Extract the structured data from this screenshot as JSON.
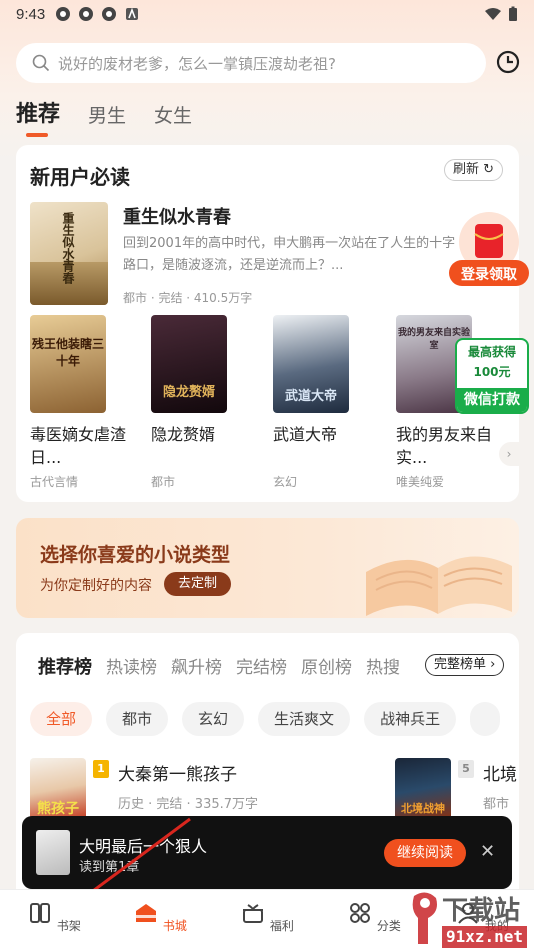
{
  "status": {
    "time": "9:43"
  },
  "search": {
    "placeholder": "说好的废材老爹，怎么一掌镇压渡劫老祖?"
  },
  "tabs": [
    {
      "label": "推荐"
    },
    {
      "label": "男生"
    },
    {
      "label": "女生"
    }
  ],
  "new_user": {
    "title": "新用户必读",
    "refresh_label": "刷新",
    "featured": {
      "title": "重生似水青春",
      "cover_text": "重生似水青春",
      "description": "回到2001年的高中时代，申大鹏再一次站在了人生的十字路口，是随波逐流，还是逆流而上？...",
      "meta": "都市 · 完结 · 410.5万字"
    },
    "books": [
      {
        "title": "毒医嫡女虐渣日...",
        "category": "古代言情",
        "cover_text": "残王他装瞎三十年",
        "colors": [
          "#d9b27a",
          "#6a4a26"
        ]
      },
      {
        "title": "隐龙赘婿",
        "category": "都市",
        "cover_text": "隐龙赘婿",
        "colors": [
          "#3a1f2a",
          "#1a0f14"
        ]
      },
      {
        "title": "武道大帝",
        "category": "玄幻",
        "cover_text": "武道大帝",
        "colors": [
          "#dfe5ea",
          "#2b3b52"
        ]
      },
      {
        "title": "我的男友来自实...",
        "category": "唯美纯爱",
        "cover_text": "我的男友来自实验室",
        "colors": [
          "#c9ccd4",
          "#5a4a5a"
        ]
      }
    ]
  },
  "float": {
    "gift_label": "登录领取",
    "wechat_top": "最高获得",
    "wechat_amount": "100元",
    "wechat_label": "微信打款"
  },
  "banner": {
    "title": "选择你喜爱的小说类型",
    "subtitle": "为你定制好的内容",
    "button": "去定制"
  },
  "ranking": {
    "tabs": [
      {
        "label": "推荐榜"
      },
      {
        "label": "热读榜"
      },
      {
        "label": "飙升榜"
      },
      {
        "label": "完结榜"
      },
      {
        "label": "原创榜"
      },
      {
        "label": "热搜"
      }
    ],
    "full_label": "完整榜单",
    "chips": [
      {
        "label": "全部"
      },
      {
        "label": "都市"
      },
      {
        "label": "玄幻"
      },
      {
        "label": "生活爽文"
      },
      {
        "label": "战神兵王"
      }
    ],
    "rows": [
      {
        "rank": "1",
        "title": "大秦第一熊孩子",
        "meta": "历史 · 完结 · 335.7万字",
        "cover_text": "熊孩子"
      },
      {
        "rank": "5",
        "title": "北境",
        "meta": "都市",
        "cover_text": "北境战神"
      }
    ]
  },
  "toast": {
    "title": "大明最后一个狠人",
    "subtitle": "读到第1章",
    "button": "继续阅读",
    "close": "✕"
  },
  "nav": [
    {
      "label": "书架",
      "icon": "bookshelf-icon"
    },
    {
      "label": "书城",
      "icon": "bookstore-icon"
    },
    {
      "label": "福利",
      "icon": "gift-icon"
    },
    {
      "label": "分类",
      "icon": "category-icon"
    },
    {
      "label": "我的",
      "icon": "profile-icon"
    }
  ],
  "watermark": {
    "text": "下载站",
    "url_text": "91xz.net"
  },
  "colors": {
    "accent": "#f05a28",
    "banner_text": "#8a3a1a"
  }
}
